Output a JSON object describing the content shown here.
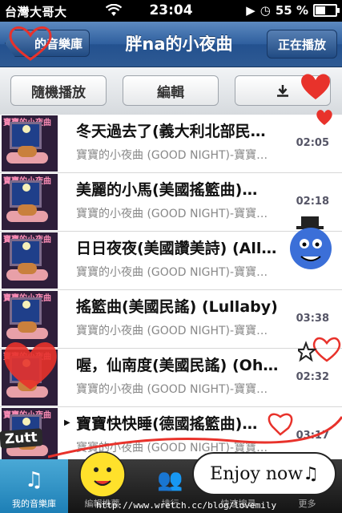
{
  "status_bar": {
    "carrier": "台灣大哥大",
    "time": "23:04",
    "battery": "55 %"
  },
  "nav": {
    "back_label": "的音樂庫",
    "title": "胖na的小夜曲",
    "now_playing_label": "正在播放"
  },
  "toolbar": {
    "shuffle_label": "隨機播放",
    "edit_label": "編輯",
    "download_icon": "download-icon"
  },
  "songs": [
    {
      "title": "冬天過去了(義大利北部民…",
      "subtitle": "寶寶的小夜曲 (GOOD NIGHT)-寶寶…",
      "duration": "02:05"
    },
    {
      "title": "美麗的小馬(美國搖籃曲)…",
      "subtitle": "寶寶的小夜曲 (GOOD NIGHT)-寶寶…",
      "duration": "02:18"
    },
    {
      "title": "日日夜夜(美國讚美詩) (All…",
      "subtitle": "寶寶的小夜曲 (GOOD NIGHT)-寶寶…",
      "duration": ""
    },
    {
      "title": "搖籃曲(美國民謠) (Lullaby)",
      "subtitle": "寶寶的小夜曲 (GOOD NIGHT)-寶寶…",
      "duration": "03:38"
    },
    {
      "title": "喔，仙南度(美國民謠) (Oh…",
      "subtitle": "寶寶的小夜曲 (GOOD NIGHT)-寶寶…",
      "duration": "02:32"
    },
    {
      "title": "寶寶快快睡(德國搖籃曲)…",
      "subtitle": "寶寶的小夜曲 (GOOD NIGHT)-寶寶…",
      "duration": "03:17"
    }
  ],
  "tabs": [
    {
      "label": "我的音樂庫",
      "icon": "music-library-icon"
    },
    {
      "label": "編輯推薦",
      "icon": "star-icon"
    },
    {
      "label": "排行",
      "icon": "people-icon"
    },
    {
      "label": "快速搜尋",
      "icon": "search-icon"
    },
    {
      "label": "更多",
      "icon": "more-icon"
    }
  ],
  "decor": {
    "enjoy_text": "Enjoy now♫",
    "watermark": "http://www.wretch.cc/blog/lovemily",
    "sticker_text": "Zutt"
  },
  "colors": {
    "nav_blue": "#2f5f9e",
    "tab_active": "#1d7fb6"
  }
}
